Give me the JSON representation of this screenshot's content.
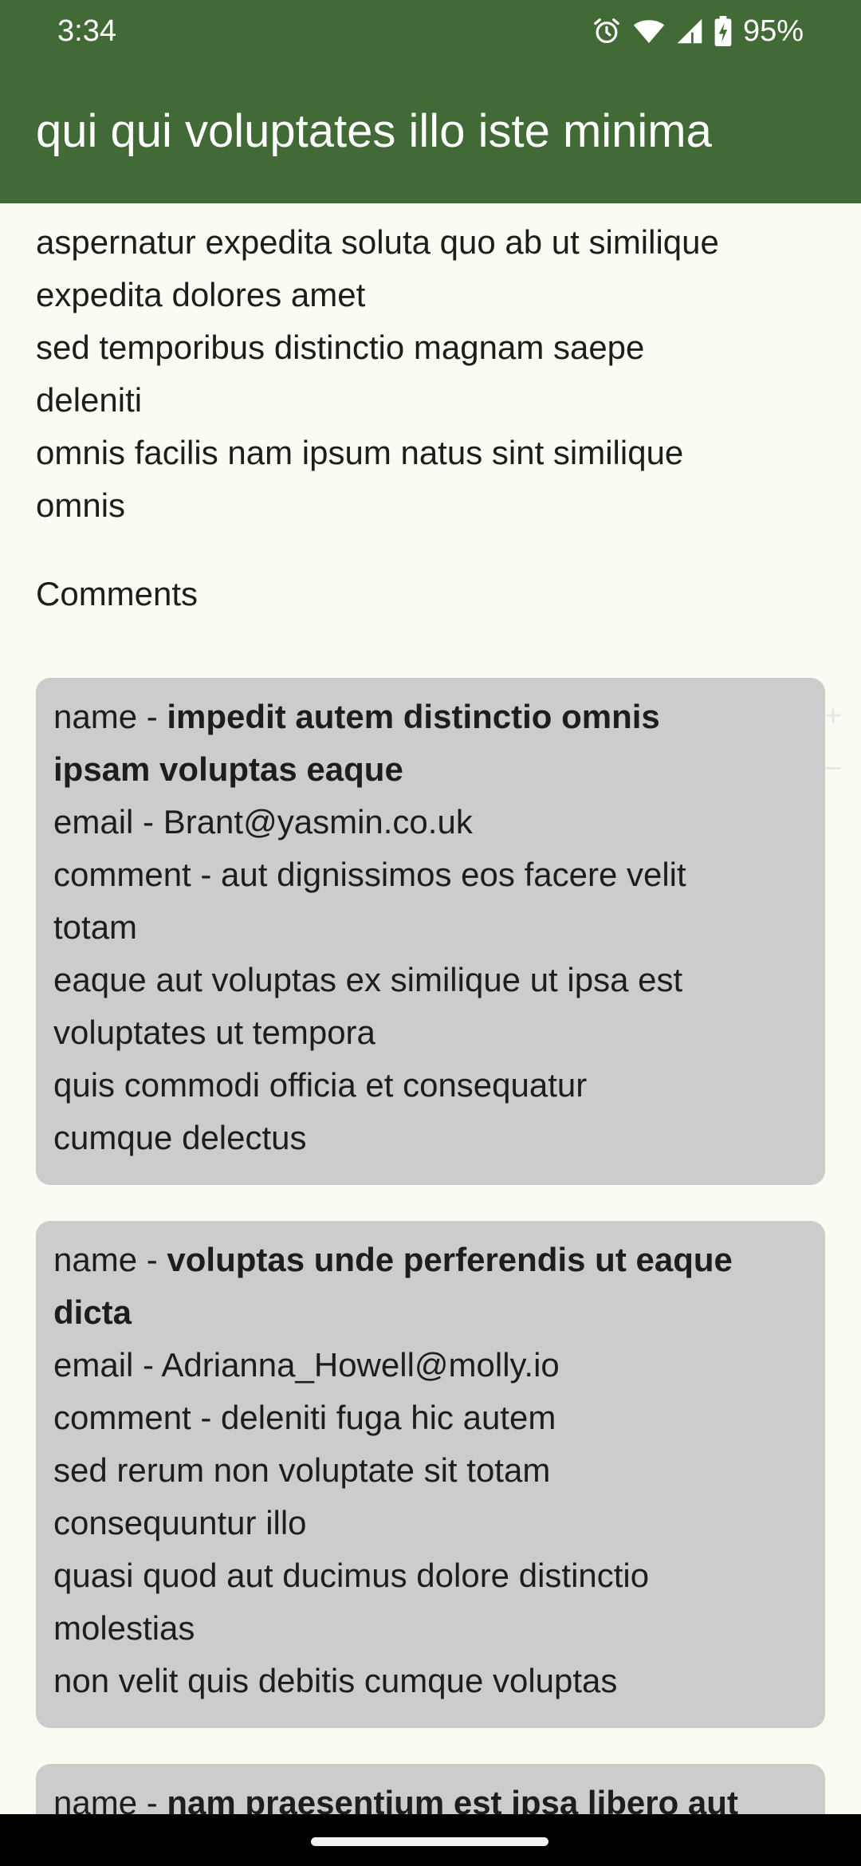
{
  "status_bar": {
    "time": "3:34",
    "battery": "95%",
    "icons": [
      "alarm-icon",
      "wifi-icon",
      "signal-icon",
      "battery-charging-icon"
    ]
  },
  "app_bar": {
    "title": "qui qui voluptates illo iste minima",
    "color": "#426a36"
  },
  "post": {
    "body_lines": [
      "aspernatur expedita soluta quo ab ut similique",
      "expedita dolores amet",
      "sed temporibus distinctio magnam saepe",
      "deleniti",
      "omnis facilis nam ipsum natus sint similique",
      "omnis"
    ]
  },
  "comments": {
    "heading": "Comments",
    "name_prefix": "name - ",
    "email_prefix": "email - ",
    "comment_prefix": "comment - ",
    "items": [
      {
        "name_lines": [
          "impedit autem distinctio omnis",
          "ipsam voluptas eaque"
        ],
        "email": "Brant@yasmin.co.uk",
        "comment_lines": [
          "aut dignissimos eos facere velit",
          "totam",
          "eaque aut voluptas ex similique ut ipsa est",
          "voluptates ut tempora",
          "quis commodi officia et consequatur",
          "cumque delectus"
        ]
      },
      {
        "name_lines": [
          "voluptas unde perferendis ut eaque",
          "dicta"
        ],
        "email": "Adrianna_Howell@molly.io",
        "comment_lines": [
          "deleniti fuga hic autem",
          "sed rerum non voluptate sit totam",
          "consequuntur illo",
          "quasi quod aut ducimus dolore distinctio",
          "molestias",
          "non velit quis debitis cumque voluptas"
        ]
      },
      {
        "name_lines": [
          "nam praesentium est ipsa libero aut"
        ]
      }
    ]
  },
  "zoom_controls": {
    "zoom_in_label": "+",
    "zoom_out_label": "−"
  }
}
